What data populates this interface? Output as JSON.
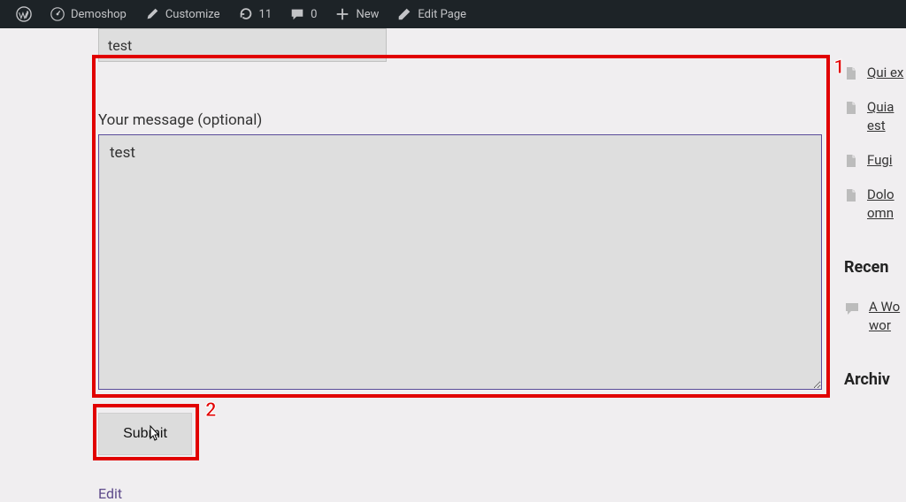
{
  "adminbar": {
    "site_name": "Demoshop",
    "customize": "Customize",
    "updates_count": "11",
    "comments_count": "0",
    "new": "New",
    "edit_page": "Edit Page"
  },
  "form": {
    "subject_value": "test",
    "message_label": "Your message (optional)",
    "message_value": "test",
    "submit_label": "Submit",
    "edit_link": "Edit"
  },
  "sidebar": {
    "posts": [
      {
        "text": "Qui ex"
      },
      {
        "text": "Quia est"
      },
      {
        "text": "Fugi"
      },
      {
        "text": "Dolo omn"
      }
    ],
    "recent_heading": "Recen",
    "recent_comment": "A Wo wor",
    "archives_heading": "Archiv"
  },
  "annotations": {
    "n1": "1",
    "n2": "2"
  }
}
